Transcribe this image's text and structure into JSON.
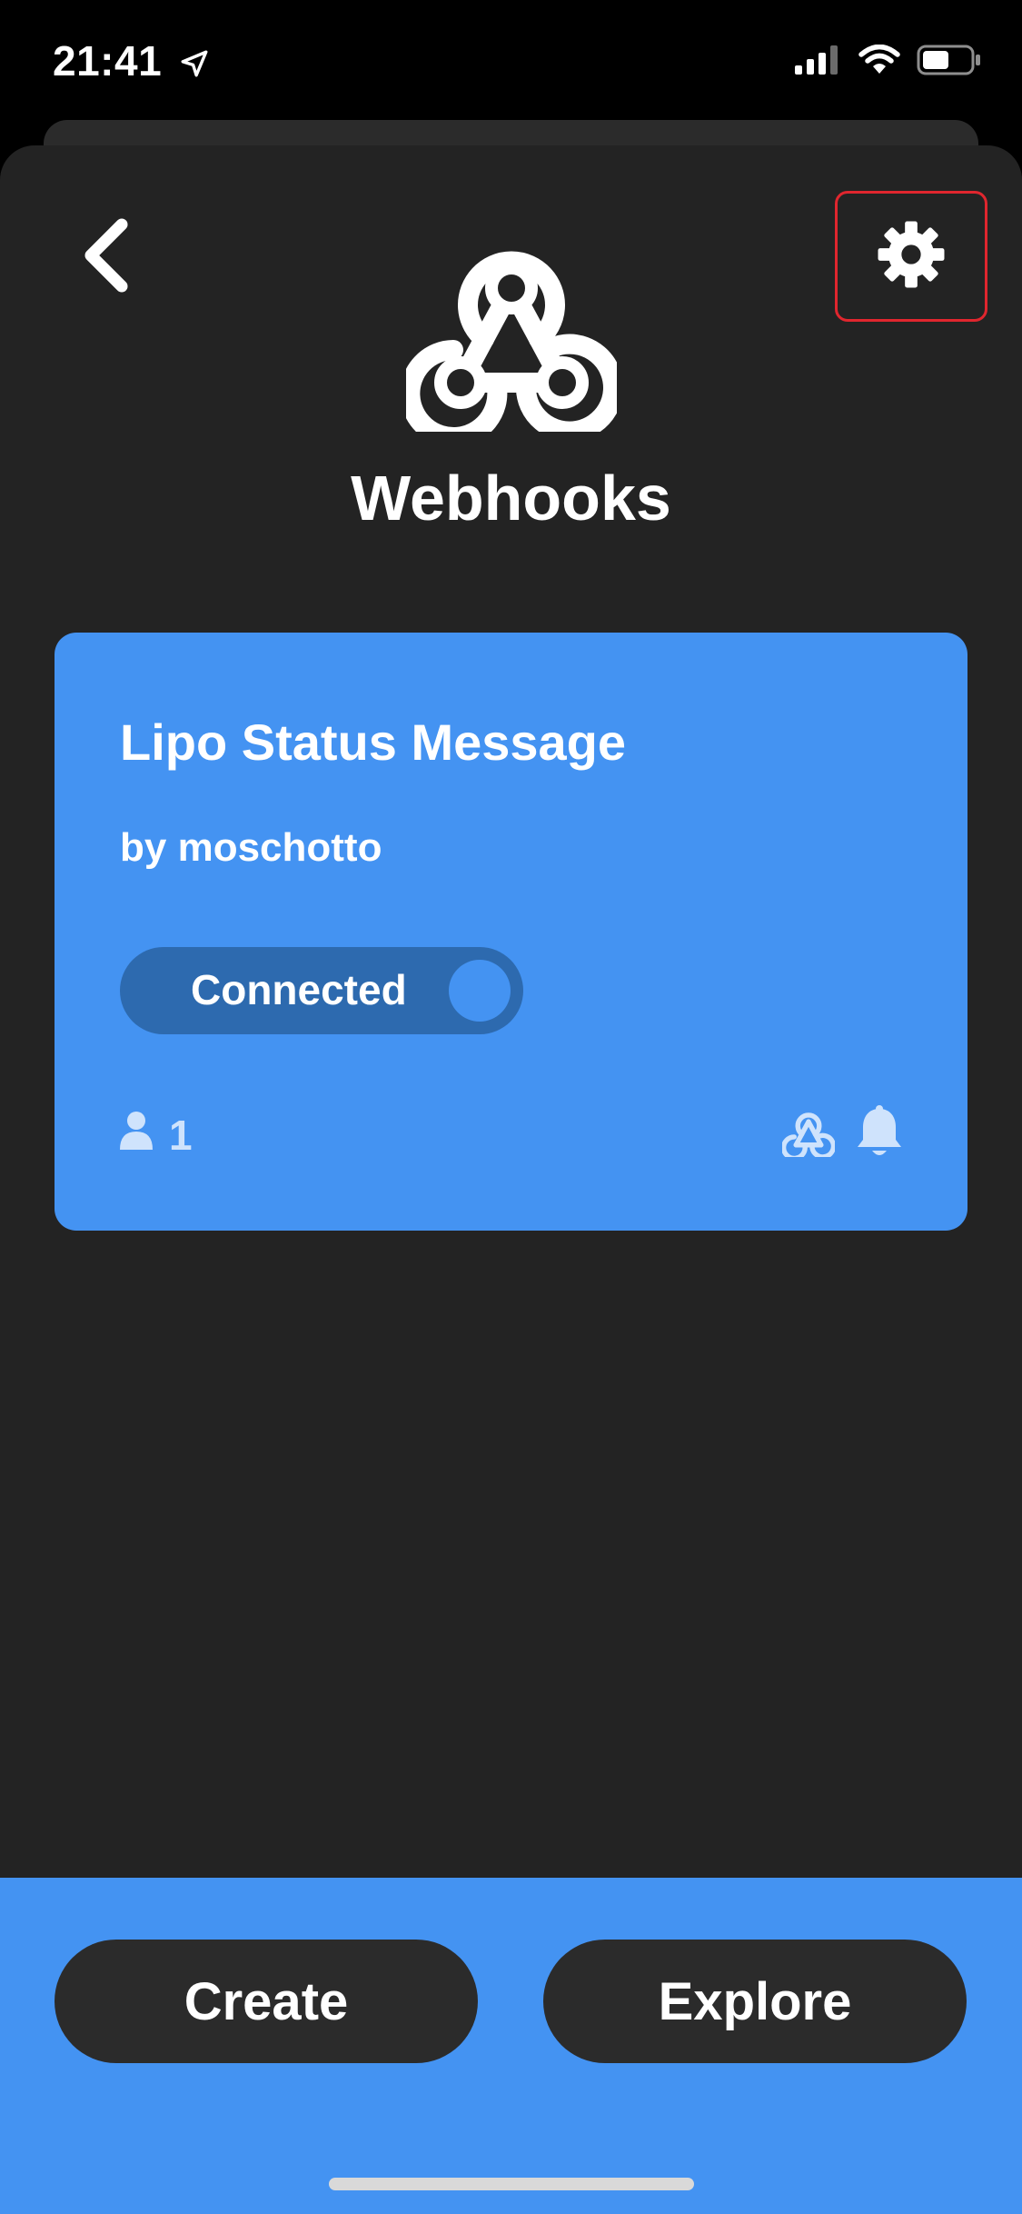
{
  "status_bar": {
    "time": "21:41",
    "icons": [
      "location-arrow-icon",
      "cellular-signal-icon",
      "wifi-icon",
      "battery-icon"
    ]
  },
  "header": {
    "service_name": "Webhooks",
    "back_icon": "chevron-left-icon",
    "settings_icon": "gear-icon",
    "logo_icon": "webhooks-logo-icon"
  },
  "applet": {
    "title": "Lipo Status Message",
    "author": "by moschotto",
    "toggle_label": "Connected",
    "user_count": "1",
    "service_icons": [
      "webhooks-icon",
      "notification-bell-icon"
    ]
  },
  "bottom_nav": {
    "create_label": "Create",
    "explore_label": "Explore"
  },
  "colors": {
    "accent": "#4493f2",
    "background": "#232323",
    "highlight_border": "#e0262e"
  }
}
